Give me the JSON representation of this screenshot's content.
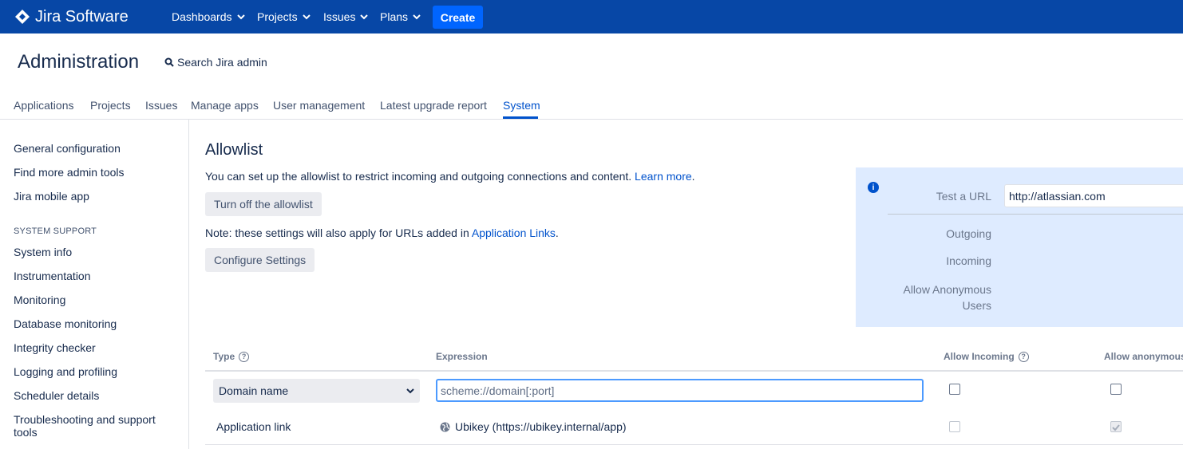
{
  "topbar": {
    "app_name": "Jira Software",
    "nav": [
      "Dashboards",
      "Projects",
      "Issues",
      "Plans"
    ],
    "create_label": "Create",
    "colors": {
      "background": "#0747a6",
      "create": "#0065ff"
    }
  },
  "admin": {
    "title": "Administration",
    "search_label": "Search Jira admin"
  },
  "tabs": [
    {
      "label": "Applications"
    },
    {
      "label": "Projects"
    },
    {
      "label": "Issues"
    },
    {
      "label": "Manage apps"
    },
    {
      "label": "User management"
    },
    {
      "label": "Latest upgrade report"
    },
    {
      "label": "System",
      "active": true
    }
  ],
  "sidebar": {
    "items_top": [
      "General configuration",
      "Find more admin tools",
      "Jira mobile app"
    ],
    "section_heading": "SYSTEM SUPPORT",
    "items_support": [
      "System info",
      "Instrumentation",
      "Monitoring",
      "Database monitoring",
      "Integrity checker",
      "Logging and profiling",
      "Scheduler details",
      "Troubleshooting and support tools"
    ]
  },
  "main": {
    "title": "Allowlist",
    "description": "You can set up the allowlist to restrict incoming and outgoing connections and content.",
    "learn_more": "Learn more",
    "turn_off_button": "Turn off the allowlist",
    "note_prefix": "Note: these settings will also apply for URLs added in",
    "note_link": "Application Links",
    "configure_button": "Configure Settings"
  },
  "test_panel": {
    "test_url_label": "Test a URL",
    "test_url_value": "http://atlassian.com",
    "outgoing_label": "Outgoing",
    "incoming_label": "Incoming",
    "anon_label_line1": "Allow Anonymous",
    "anon_label_line2": "Users"
  },
  "table": {
    "headers": {
      "type": "Type",
      "expression": "Expression",
      "allow_incoming": "Allow Incoming",
      "allow_anonymous": "Allow anonymous"
    },
    "new_row": {
      "type_value": "Domain name",
      "expression_placeholder": "scheme://domain[:port]",
      "allow_incoming": false,
      "allow_anonymous": false
    },
    "rows": [
      {
        "type": "Application link",
        "expression": "Ubikey (https://ubikey.internal/app)",
        "allow_incoming": false,
        "allow_anonymous": true
      }
    ]
  }
}
